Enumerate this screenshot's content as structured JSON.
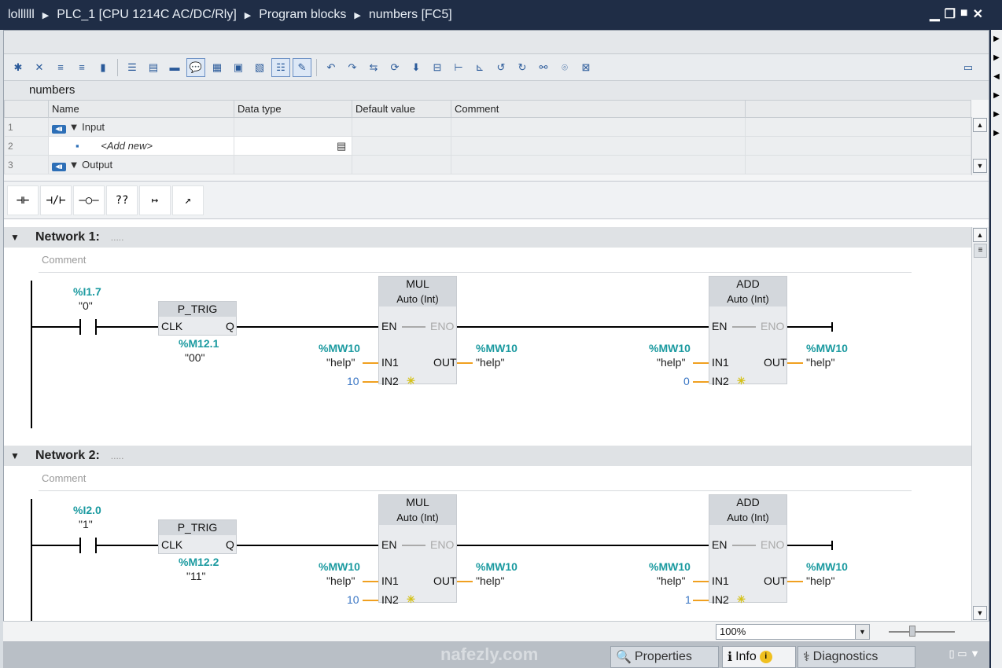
{
  "breadcrumb": [
    "lollllll",
    "PLC_1 [CPU 1214C AC/DC/Rly]",
    "Program blocks",
    "numbers [FC5]"
  ],
  "window_buttons": [
    "minimize",
    "restore",
    "maximize",
    "close"
  ],
  "block_title": "numbers",
  "interface": {
    "columns": [
      "Name",
      "Data type",
      "Default value",
      "Comment"
    ],
    "rows": [
      {
        "num": "1",
        "name": "Input",
        "kind": "section"
      },
      {
        "num": "2",
        "name": "<Add new>",
        "kind": "add"
      },
      {
        "num": "3",
        "name": "Output",
        "kind": "section"
      }
    ]
  },
  "ladder_toolbar": [
    "-||-",
    "-|/|-",
    "-()-",
    "??",
    "branch-open",
    "branch-close"
  ],
  "networks": [
    {
      "title": "Network 1:",
      "dots": ".....",
      "comment": "Comment",
      "contact": {
        "address": "%I1.7",
        "tag": "\"0\""
      },
      "ptrig": {
        "name": "P_TRIG",
        "clk": "CLK",
        "q": "Q",
        "address": "%M12.1",
        "tag": "\"00\""
      },
      "mul": {
        "name": "MUL",
        "type": "Auto (Int)",
        "in1_addr": "%MW10",
        "in1_tag": "\"help\"",
        "in2": "10",
        "out_addr": "%MW10",
        "out_tag": "\"help\""
      },
      "add": {
        "name": "ADD",
        "type": "Auto (Int)",
        "in1_addr": "%MW10",
        "in1_tag": "\"help\"",
        "in2": "0",
        "out_addr": "%MW10",
        "out_tag": "\"help\""
      }
    },
    {
      "title": "Network 2:",
      "dots": ".....",
      "comment": "Comment",
      "contact": {
        "address": "%I2.0",
        "tag": "\"1\""
      },
      "ptrig": {
        "name": "P_TRIG",
        "clk": "CLK",
        "q": "Q",
        "address": "%M12.2",
        "tag": "\"11\""
      },
      "mul": {
        "name": "MUL",
        "type": "Auto (Int)",
        "in1_addr": "%MW10",
        "in1_tag": "\"help\"",
        "in2": "10",
        "out_addr": "%MW10",
        "out_tag": "\"help\""
      },
      "add": {
        "name": "ADD",
        "type": "Auto (Int)",
        "in1_addr": "%MW10",
        "in1_tag": "\"help\"",
        "in2": "1",
        "out_addr": "%MW10",
        "out_tag": "\"help\""
      }
    }
  ],
  "pins": {
    "en": "EN",
    "eno": "ENO",
    "in1": "IN1",
    "in2": "IN2",
    "out": "OUT"
  },
  "zoom": "100%",
  "bottom_tabs": {
    "properties": "Properties",
    "info": "Info",
    "diagnostics": "Diagnostics"
  },
  "watermark": "nafezly.com",
  "colors": {
    "title_bg": "#1f2d46",
    "operand": "#1b9aa0",
    "constant": "#3a76c4",
    "wire_orange": "#f0a020"
  }
}
